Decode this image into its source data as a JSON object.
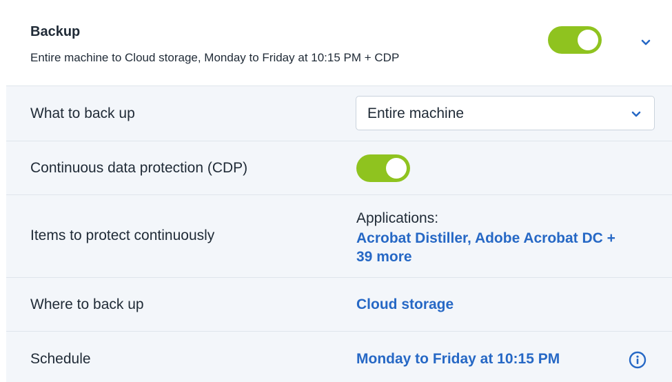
{
  "backup_section": {
    "title": "Backup",
    "summary": "Entire machine to Cloud storage, Monday to Friday at 10:15 PM + CDP",
    "enabled": true,
    "accent_color": "#8fc31f",
    "expand_icon": "chevron-down-icon"
  },
  "rows": {
    "what_to_back_up": {
      "label": "What to back up",
      "selected": "Entire machine",
      "dropdown_icon": "chevron-down-icon"
    },
    "cdp": {
      "label": "Continuous data protection (CDP)",
      "enabled": true
    },
    "items_to_protect": {
      "label": "Items to protect continuously",
      "prefix": "Applications:",
      "link_line1": "Acrobat Distiller, Adobe Acrobat DC +",
      "link_line2": "39 more"
    },
    "where_to_back_up": {
      "label": "Where to back up",
      "value": "Cloud storage"
    },
    "schedule": {
      "label": "Schedule",
      "value": "Monday to Friday at 10:15 PM",
      "info_icon": "info-icon"
    }
  },
  "colors": {
    "link": "#2668c5",
    "row_background": "#f3f6fa",
    "divider": "#dfe5ec"
  }
}
